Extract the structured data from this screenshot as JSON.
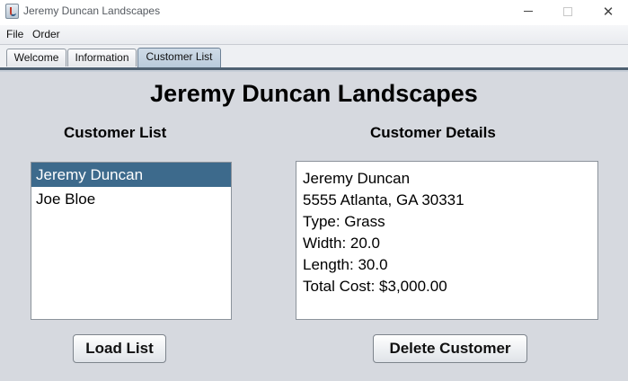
{
  "window": {
    "title": "Jeremy Duncan Landscapes",
    "controls": {
      "minimize": "minimize",
      "maximize": "maximize",
      "close": "✕"
    }
  },
  "menu": {
    "items": [
      "File",
      "Order"
    ]
  },
  "tabs": {
    "items": [
      {
        "label": "Welcome",
        "selected": false
      },
      {
        "label": "Information",
        "selected": false
      },
      {
        "label": "Customer List",
        "selected": true
      }
    ]
  },
  "main": {
    "title": "Jeremy Duncan Landscapes",
    "customer_list": {
      "heading": "Customer List",
      "items": [
        {
          "name": "Jeremy Duncan",
          "selected": true
        },
        {
          "name": "Joe Bloe",
          "selected": false
        }
      ]
    },
    "customer_details": {
      "heading": "Customer Details",
      "lines": [
        "Jeremy Duncan",
        "5555 Atlanta, GA 30331",
        "Type: Grass",
        "Width: 20.0",
        "Length: 30.0",
        "Total Cost: $3,000.00"
      ]
    },
    "buttons": {
      "load": "Load List",
      "delete": "Delete Customer"
    }
  },
  "colors": {
    "selection": "#3d6a8c",
    "background": "#d6d9df",
    "tab_selected": "#b8cadb"
  }
}
